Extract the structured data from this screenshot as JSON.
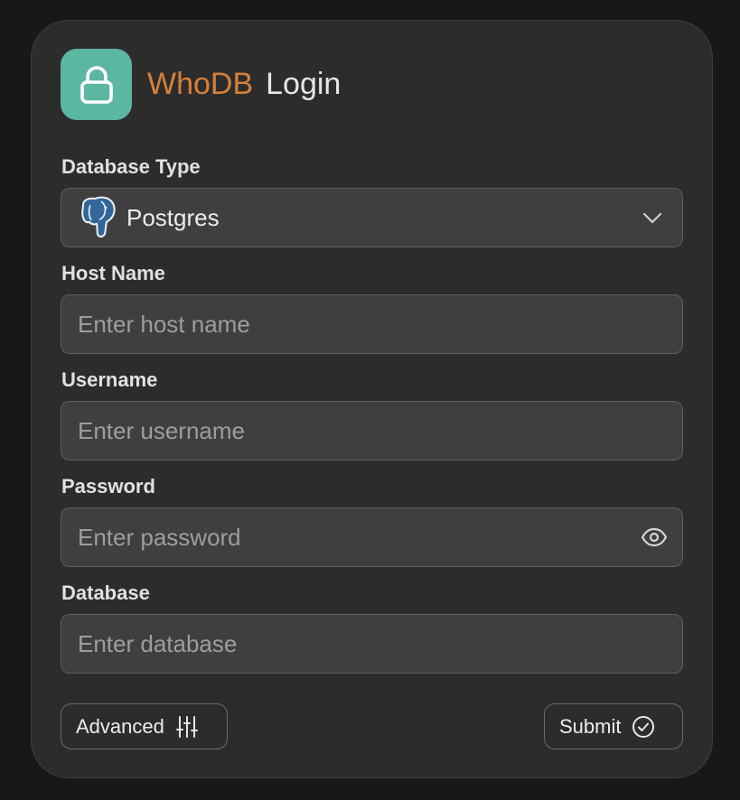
{
  "header": {
    "brand": "WhoDB",
    "title": "Login"
  },
  "icons": {
    "logo": "lock-icon",
    "db_type": "postgres-elephant-icon",
    "dropdown": "chevron-down-icon",
    "password_toggle": "eye-icon",
    "advanced": "sliders-icon",
    "submit": "check-circle-icon"
  },
  "colors": {
    "brand": "#d4803b",
    "logo_background": "#5bb7a1",
    "card_background": "#2c2c2c",
    "page_background": "#181818"
  },
  "form": {
    "database_type": {
      "label": "Database Type",
      "selected": "Postgres"
    },
    "host_name": {
      "label": "Host Name",
      "value": "",
      "placeholder": "Enter host name"
    },
    "username": {
      "label": "Username",
      "value": "",
      "placeholder": "Enter username"
    },
    "password": {
      "label": "Password",
      "value": "",
      "placeholder": "Enter password"
    },
    "database": {
      "label": "Database",
      "value": "",
      "placeholder": "Enter database"
    }
  },
  "actions": {
    "advanced_label": "Advanced",
    "submit_label": "Submit"
  }
}
